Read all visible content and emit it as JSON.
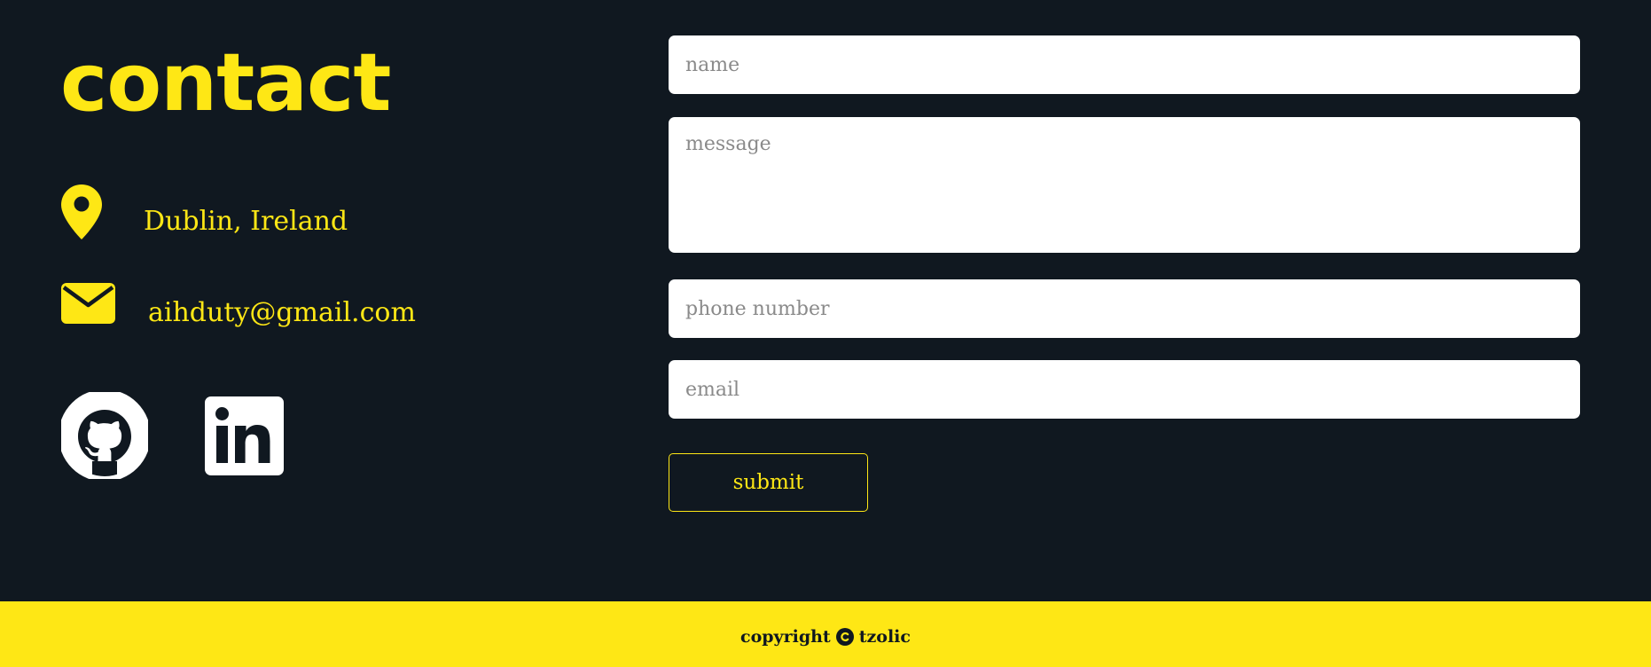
{
  "contact": {
    "title": "contact",
    "location": "Dublin, Ireland",
    "email": "aihduty@gmail.com"
  },
  "social": {
    "github_icon": "github-icon",
    "linkedin_icon": "linkedin-icon"
  },
  "form": {
    "name_placeholder": "name",
    "message_placeholder": "message",
    "phone_placeholder": "phone number",
    "email_placeholder": "email",
    "submit_label": "submit"
  },
  "footer": {
    "copyright_label": "copyright",
    "author": "tzolic"
  },
  "colors": {
    "background": "#101820",
    "accent": "#fee715",
    "field_background": "#ffffff",
    "placeholder": "#8a8a8a"
  }
}
